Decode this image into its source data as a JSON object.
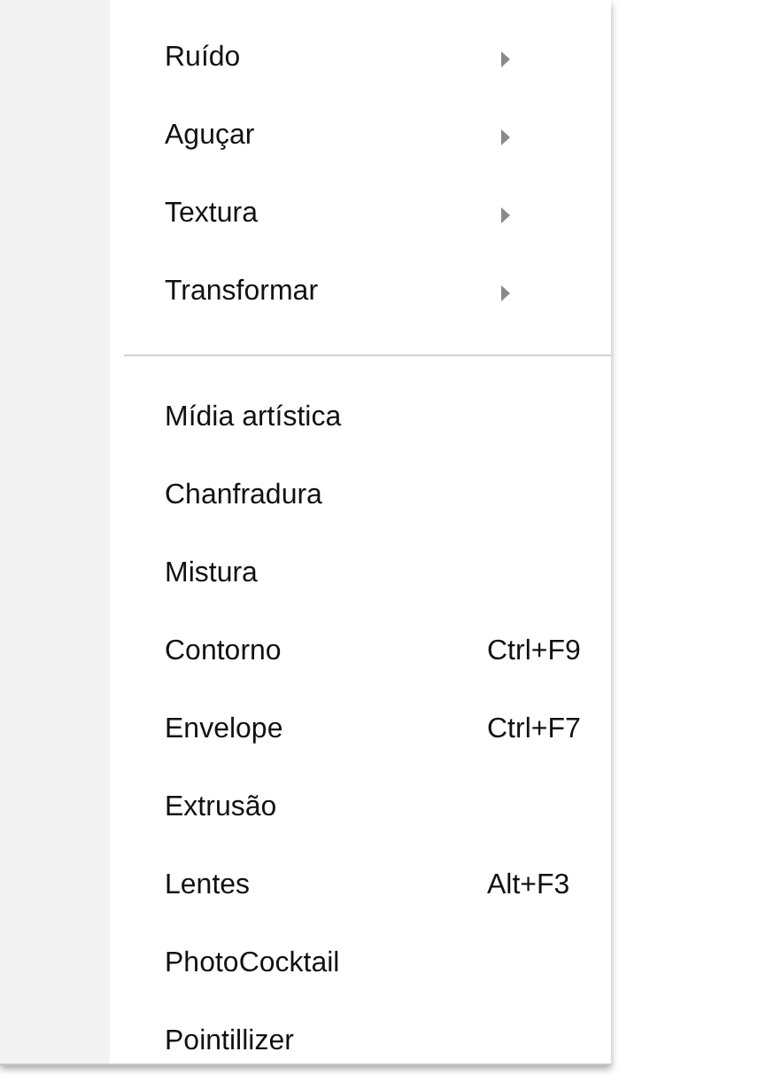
{
  "menu": {
    "groups": [
      {
        "items": [
          {
            "label": "Ruído",
            "submenu": true
          },
          {
            "label": "Aguçar",
            "submenu": true
          },
          {
            "label": "Textura",
            "submenu": true
          },
          {
            "label": "Transformar",
            "submenu": true
          }
        ]
      },
      {
        "items": [
          {
            "label": "Mídia artística",
            "submenu": false
          },
          {
            "label": "Chanfradura",
            "submenu": false
          },
          {
            "label": "Mistura",
            "submenu": false
          },
          {
            "label": "Contorno",
            "submenu": false,
            "shortcut": "Ctrl+F9"
          },
          {
            "label": "Envelope",
            "submenu": false,
            "shortcut": "Ctrl+F7"
          },
          {
            "label": "Extrusão",
            "submenu": false
          },
          {
            "label": "Lentes",
            "submenu": false,
            "shortcut": "Alt+F3"
          },
          {
            "label": "PhotoCocktail",
            "submenu": false
          },
          {
            "label": "Pointillizer",
            "submenu": false
          }
        ]
      }
    ]
  }
}
